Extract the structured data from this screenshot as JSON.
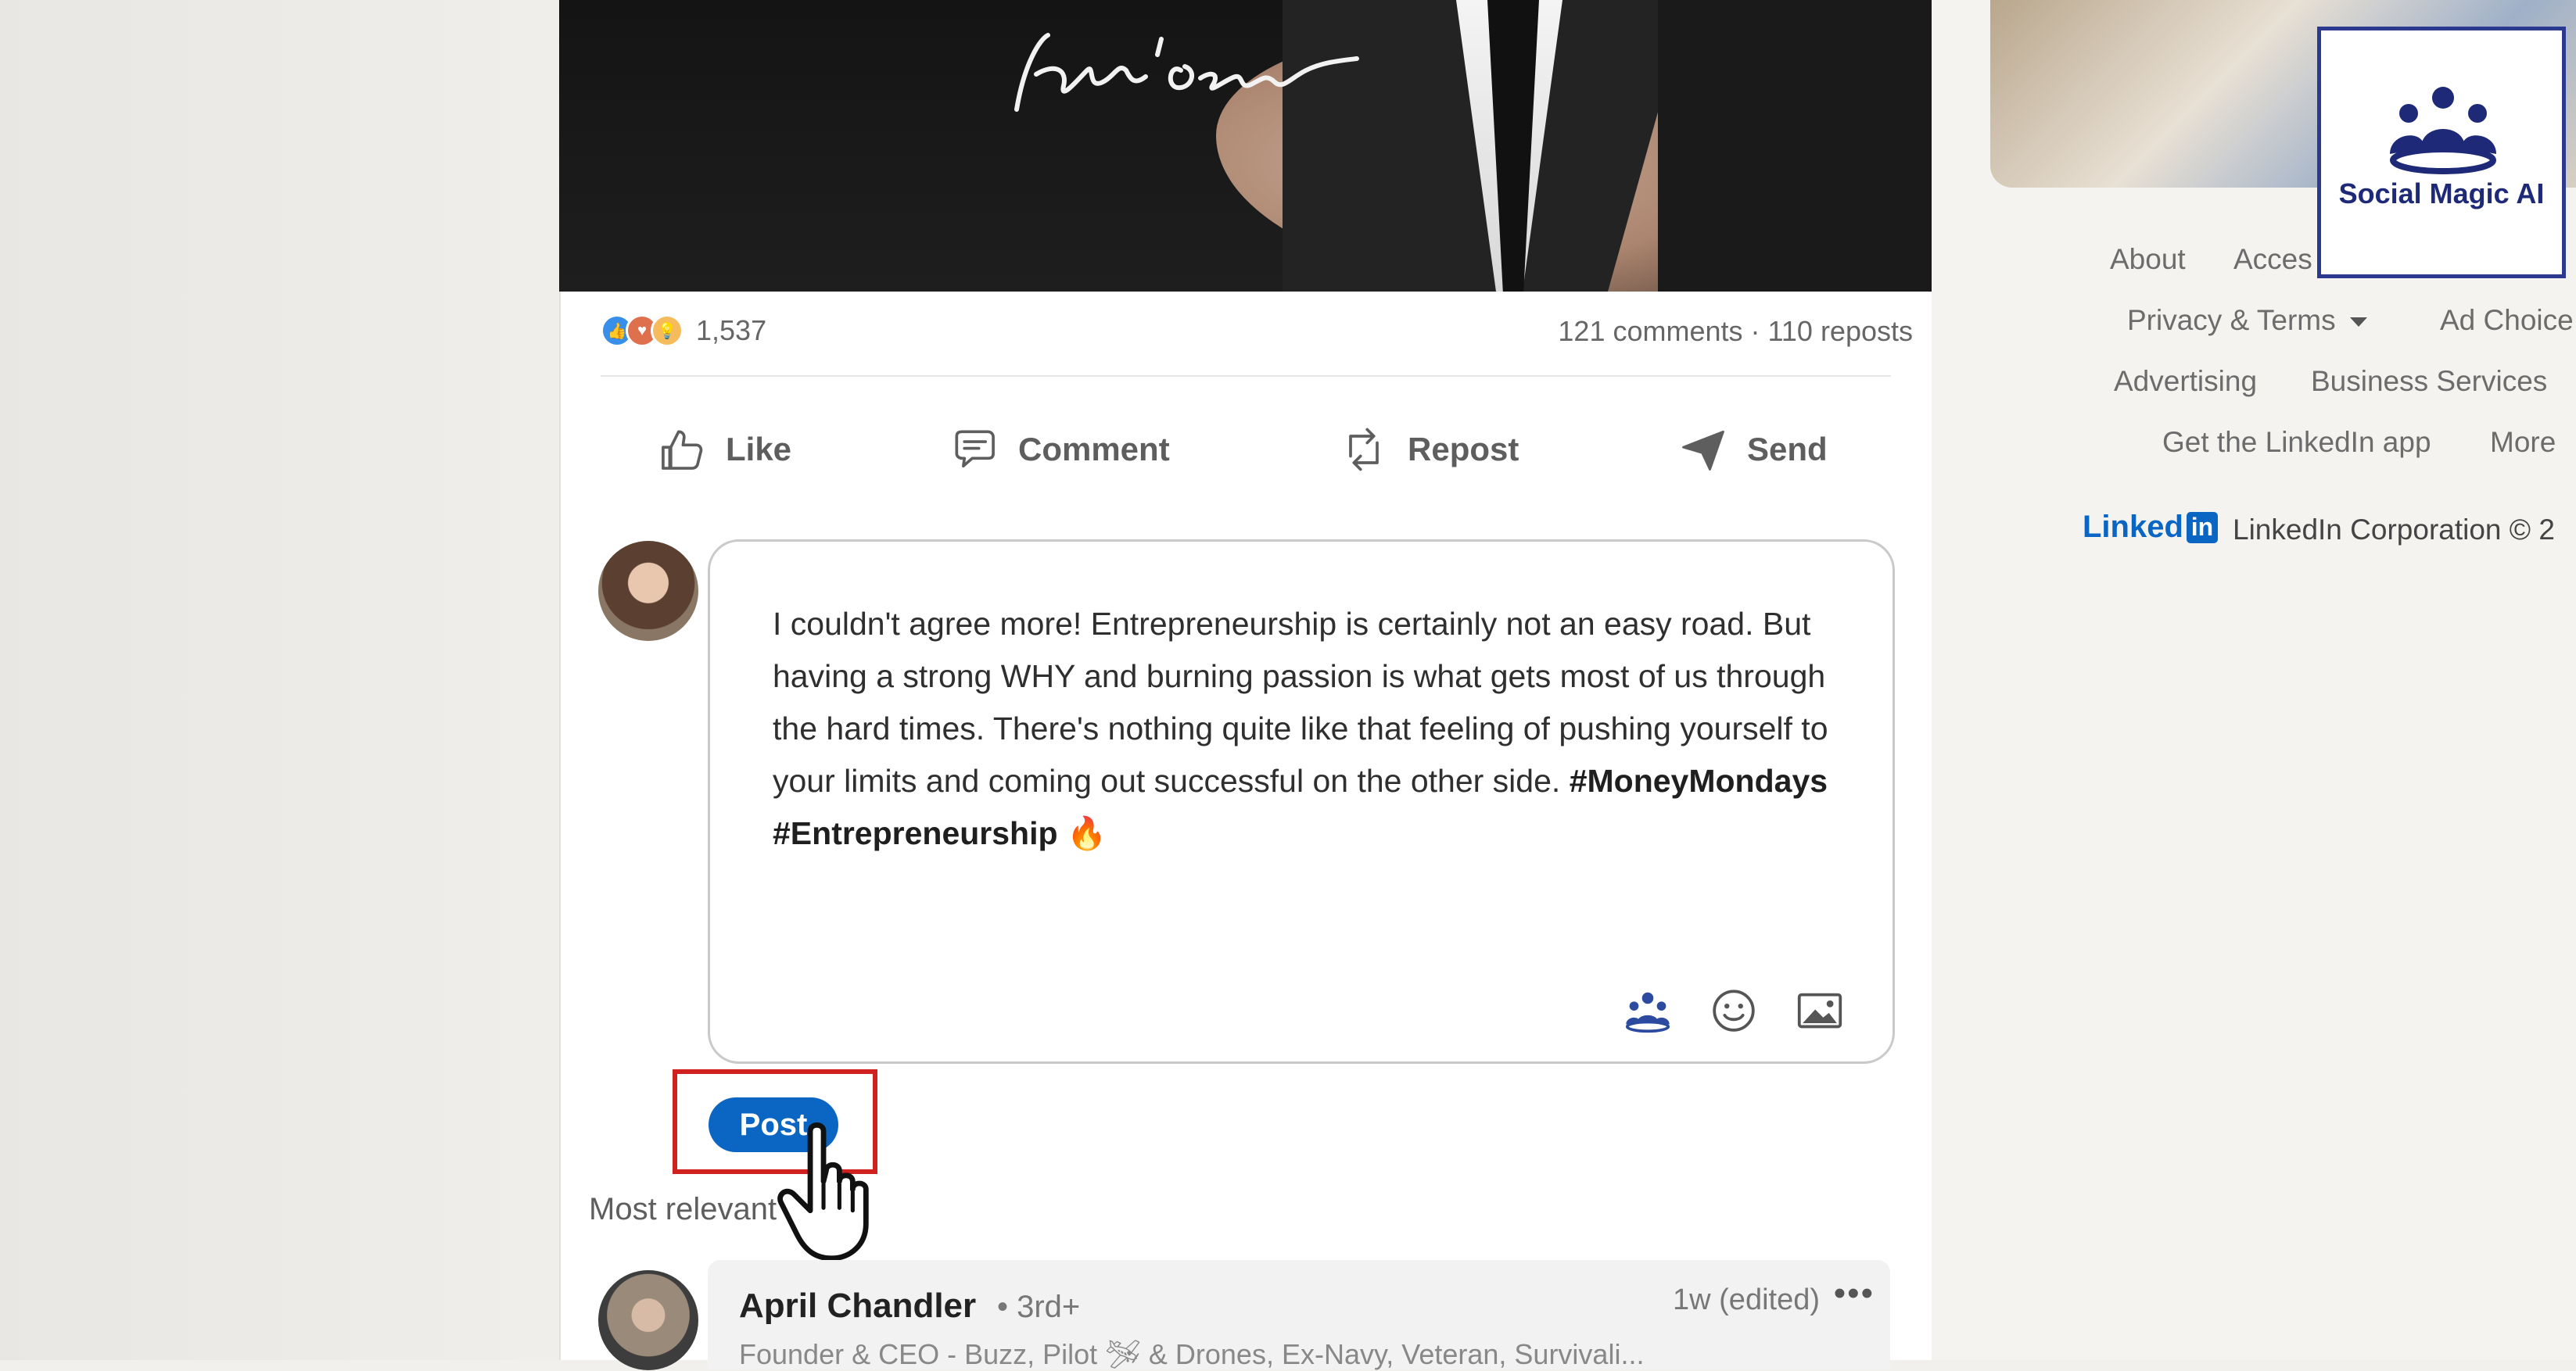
{
  "post": {
    "reaction_count": "1,537",
    "comments": "121 comments",
    "separator": "·",
    "reposts": "110 reposts"
  },
  "actions": {
    "like": "Like",
    "comment": "Comment",
    "repost": "Repost",
    "send": "Send"
  },
  "composer": {
    "text": "I couldn't agree more! Entrepreneurship is certainly not an easy road. But having a strong WHY and burning passion is what gets most of us through the hard times. There's nothing quite like that feeling of pushing yourself to your limits and coming out successful on the other side.",
    "hashtag1": "#MoneyMondays",
    "hashtag2": "#Entrepreneurship",
    "emoji": "🔥",
    "post_button": "Post"
  },
  "comments_section": {
    "sort_label": "Most relevant",
    "first_comment": {
      "name": "April Chandler",
      "degree": "• 3rd+",
      "time": "1w (edited)",
      "more": "•••",
      "headline": "Founder & CEO - Buzz, Pilot 🛩 & Drones, Ex-Navy, Veteran, Survivali..."
    }
  },
  "sidebar_footer": {
    "about": "About",
    "accessibility": "Acces",
    "privacy_terms": "Privacy & Terms",
    "ad_choices": "Ad Choice",
    "advertising": "Advertising",
    "business_services": "Business Services",
    "get_app": "Get the LinkedIn app",
    "more": "More",
    "linkedin_word": "Linked",
    "linkedin_in": "in",
    "copyright": "LinkedIn Corporation © 2"
  },
  "watermark": {
    "text": "Social Magic AI"
  },
  "colors": {
    "linkedin_blue": "#0a66c2",
    "highlight_red": "#d02020",
    "watermark_navy": "#1e2a78"
  },
  "icons": [
    "thumb-up-icon",
    "comment-icon",
    "repost-icon",
    "send-icon",
    "mention-group-icon",
    "emoji-icon",
    "image-icon",
    "pointer-hand-icon"
  ]
}
